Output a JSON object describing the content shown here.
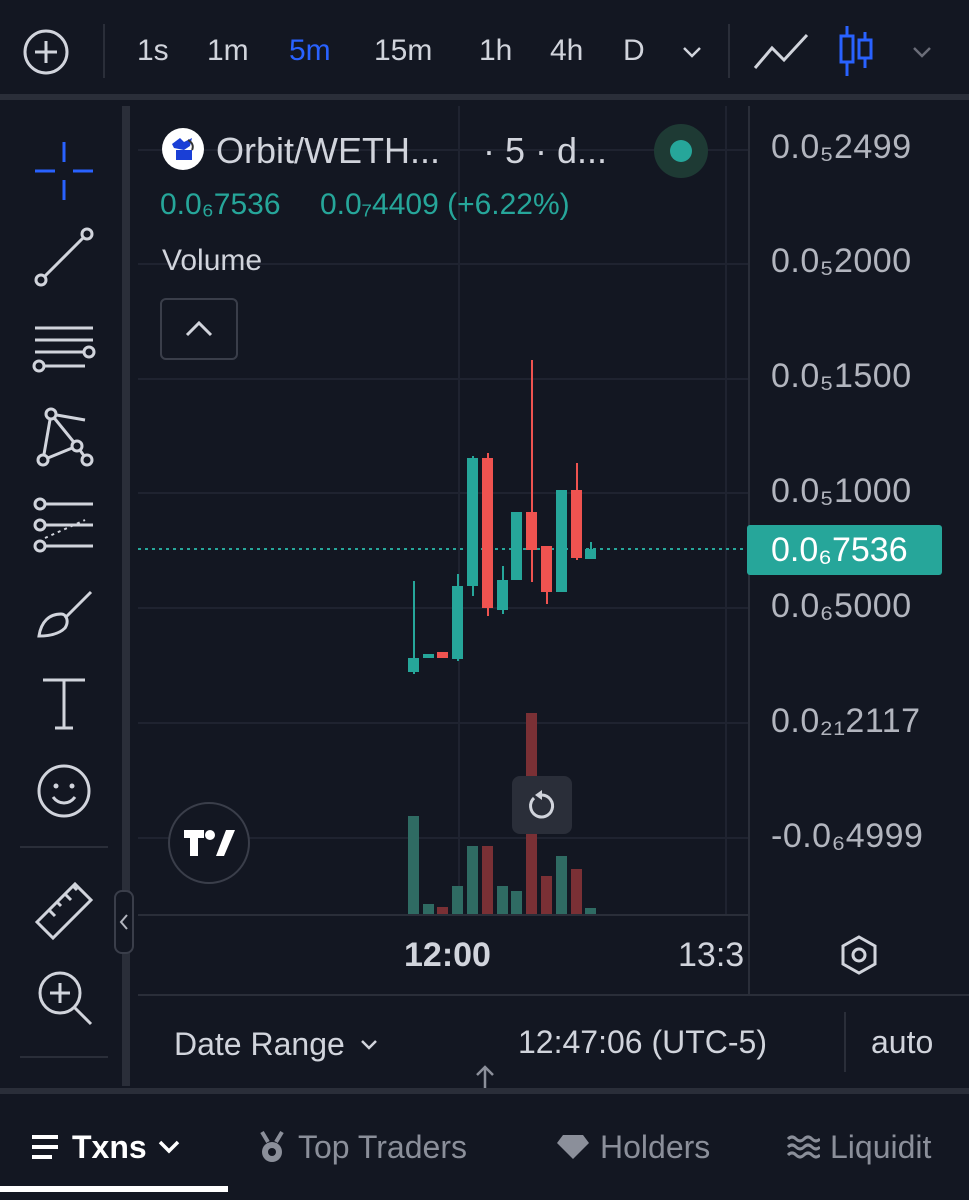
{
  "toolbar": {
    "intervals": [
      "1s",
      "1m",
      "5m",
      "15m",
      "1h",
      "4h",
      "D"
    ],
    "active_interval": "5m",
    "accent_color": "#2962ff"
  },
  "legend": {
    "symbol": "Orbit/WETH...",
    "meta": "· 5 · d...",
    "close": "0.0₆7536",
    "change": "0.0₇4409 (+6.22%)",
    "volume_label": "Volume",
    "up_color": "#26a69a"
  },
  "price_axis": {
    "labels": [
      "0.0₅2499",
      "0.0₅2000",
      "0.0₅1500",
      "0.0₅1000",
      "0.0₆5000",
      "0.0₂₁2117",
      "-0.0₆4999"
    ],
    "current_price": "0.0₆7536"
  },
  "time_axis": {
    "labels": [
      "12:00",
      "13:3"
    ]
  },
  "footer": {
    "date_range": "Date Range",
    "clock": "12:47:06 (UTC-5)",
    "scale": "auto"
  },
  "bottom_tabs": [
    "Txns",
    "Top Traders",
    "Holders",
    "Liquidit"
  ]
}
